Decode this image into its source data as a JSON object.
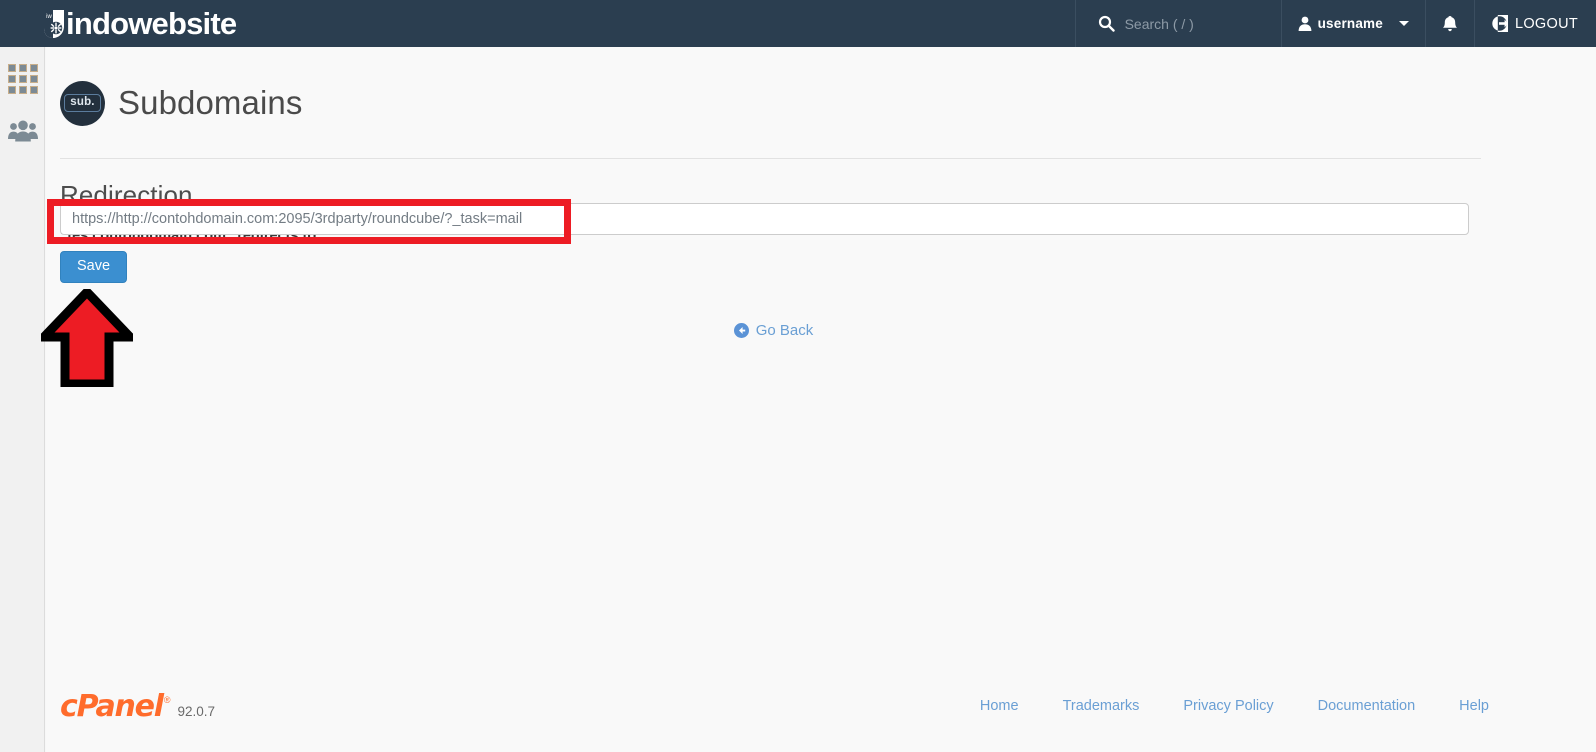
{
  "header": {
    "brand": "indowebsite",
    "brand_logo_icon": "indowebsite-teardrop-logo",
    "brand_logo_text": "iw",
    "search": {
      "icon": "search-icon",
      "placeholder": "Search ( / )",
      "value": ""
    },
    "user": {
      "icon": "user-icon",
      "name": "username",
      "caret_icon": "chevron-down-icon"
    },
    "notifications_icon": "bell-icon",
    "logout": {
      "icon": "logout-icon",
      "label": "LOGOUT"
    }
  },
  "sidebar": {
    "items": [
      {
        "icon": "apps-grid-icon",
        "name": "apps"
      },
      {
        "icon": "users-group-icon",
        "name": "user-manager"
      }
    ]
  },
  "page": {
    "icon_badge": "sub.",
    "title": "Subdomains",
    "section_title": "Redirection",
    "redirect_label": "“tes.contohdomain.com” redirects to:",
    "url_value": "https://http://contohdomain.com:2095/3rdparty/roundcube/?_task=mail",
    "url_placeholder": "https://http://contohdomain.com:2095/3rdparty/roundcube/?_task=mail",
    "save_label": "Save",
    "go_back": {
      "icon": "arrow-circle-left-icon",
      "label": "Go Back"
    }
  },
  "footer": {
    "brand": "cPanel",
    "registered_mark": "®",
    "version": "92.0.7",
    "links": [
      {
        "label": "Home"
      },
      {
        "label": "Trademarks"
      },
      {
        "label": "Privacy Policy"
      },
      {
        "label": "Documentation"
      },
      {
        "label": "Help"
      }
    ]
  },
  "annotations": {
    "highlight_box_color": "#ed1c24",
    "arrow_fill_color": "#ed1c24",
    "arrow_outline_color": "#000000"
  },
  "colors": {
    "header_bg": "#2b3e50",
    "accent_blue": "#3b8fd0",
    "link_blue": "#6a9fd4",
    "cpanel_orange": "#ff6c2c"
  }
}
